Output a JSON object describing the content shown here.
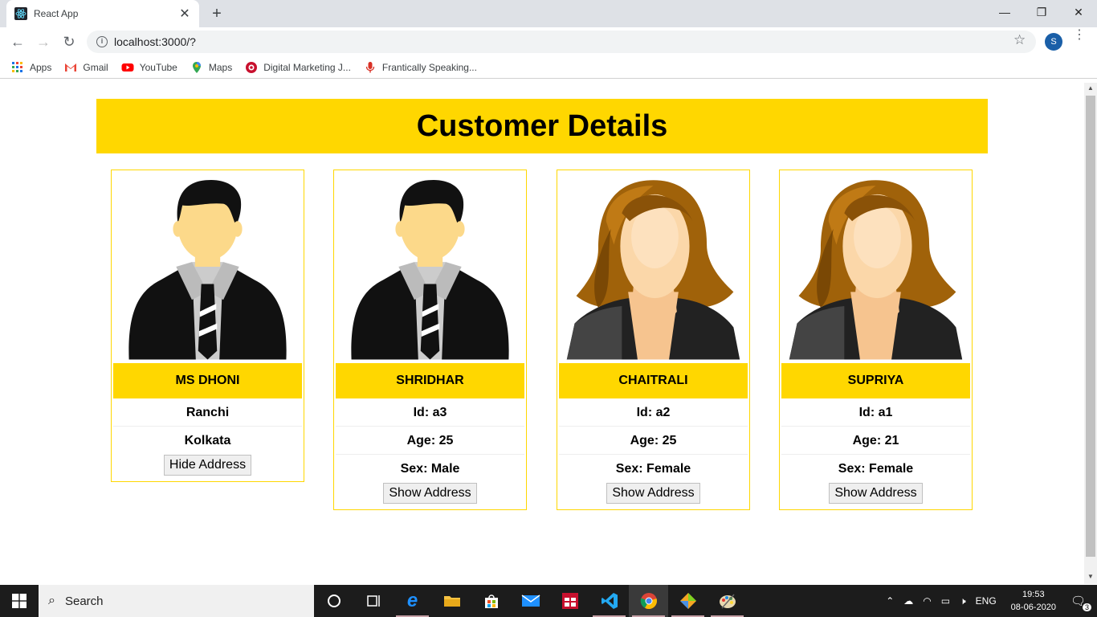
{
  "browser": {
    "tab_title": "React App",
    "url": "localhost:3000/?",
    "profile_initial": "S",
    "bookmarks": [
      {
        "label": "Apps",
        "icon": "apps-grid-icon"
      },
      {
        "label": "Gmail",
        "icon": "gmail-icon"
      },
      {
        "label": "YouTube",
        "icon": "youtube-icon"
      },
      {
        "label": "Maps",
        "icon": "maps-icon"
      },
      {
        "label": "Digital Marketing J...",
        "icon": "bookmark-red-icon"
      },
      {
        "label": "Frantically Speaking...",
        "icon": "microphone-icon"
      }
    ]
  },
  "page": {
    "heading": "Customer Details",
    "accent": "#ffd700",
    "customers": [
      {
        "name": "MS DHONI",
        "gender": "male",
        "lines": [
          "Ranchi",
          "Kolkata"
        ],
        "button": "Hide Address"
      },
      {
        "name": "SHRIDHAR",
        "gender": "male",
        "lines": [
          "Id: a3",
          "Age: 25",
          "Sex: Male"
        ],
        "button": "Show Address"
      },
      {
        "name": "CHAITRALI",
        "gender": "female",
        "lines": [
          "Id: a2",
          "Age: 25",
          "Sex: Female"
        ],
        "button": "Show Address"
      },
      {
        "name": "SUPRIYA",
        "gender": "female",
        "lines": [
          "Id: a1",
          "Age: 21",
          "Sex: Female"
        ],
        "button": "Show Address"
      }
    ]
  },
  "taskbar": {
    "search_placeholder": "Search",
    "language": "ENG",
    "time": "19:53",
    "date": "08-06-2020",
    "notification_count": "3"
  }
}
